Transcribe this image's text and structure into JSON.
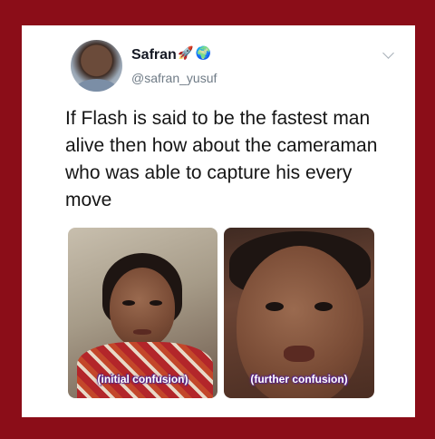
{
  "tweet": {
    "display_name": "Safran",
    "badges": [
      "rocket-icon",
      "globe-icon"
    ],
    "handle": "@safran_yusuf",
    "text": "If Flash is said to be the fastest man alive then how about the cameraman who was able to capture his every move"
  },
  "images": [
    {
      "caption": "(initial confusion)"
    },
    {
      "caption": "(further confusion)"
    }
  ],
  "colors": {
    "frame": "#8b0d18",
    "card": "#ffffff",
    "caption_outline": "#5b2a86"
  }
}
